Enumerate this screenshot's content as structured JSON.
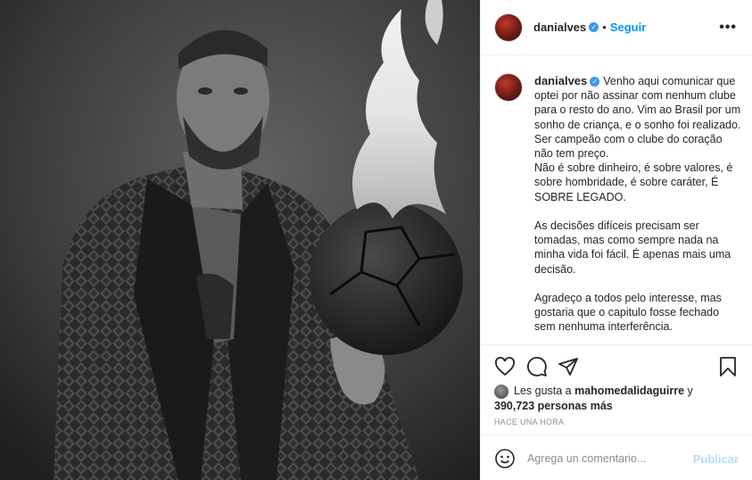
{
  "post": {
    "username": "danialves",
    "follow_label": "Seguir",
    "separator": "•",
    "more_label": "•••"
  },
  "caption": {
    "username": "danialves",
    "text": "Venho aqui comunicar que optei por não assinar com nenhum clube para o resto do ano. Vim ao Brasil por um sonho de criança, e o sonho foi realizado. Ser campeão com o clube do coração não tem preço.\nNão é sobre dinheiro, é sobre valores, é sobre hombridade, é sobre caráter, É SOBRE LEGADO.\n\nAs decisões difíceis precisam ser tomadas, mas como sempre nada na minha vida foi fácil. É apenas mais uma decisão.\n\nAgradeço a todos pelo interesse, mas gostaria que o capitulo fosse fechado sem nenhuma interferência."
  },
  "likes": {
    "prefix": "Les gusta a ",
    "user": "mahomedalidaguirre",
    "middle": " y",
    "count": "390,723 personas más"
  },
  "time": "HACE UNA HORA",
  "comment": {
    "placeholder": "Agrega un comentario...",
    "publish_label": "Publicar"
  },
  "colors": {
    "accent": "#0095f6",
    "publish_disabled": "#b3dbff",
    "verified": "#3897f0"
  }
}
